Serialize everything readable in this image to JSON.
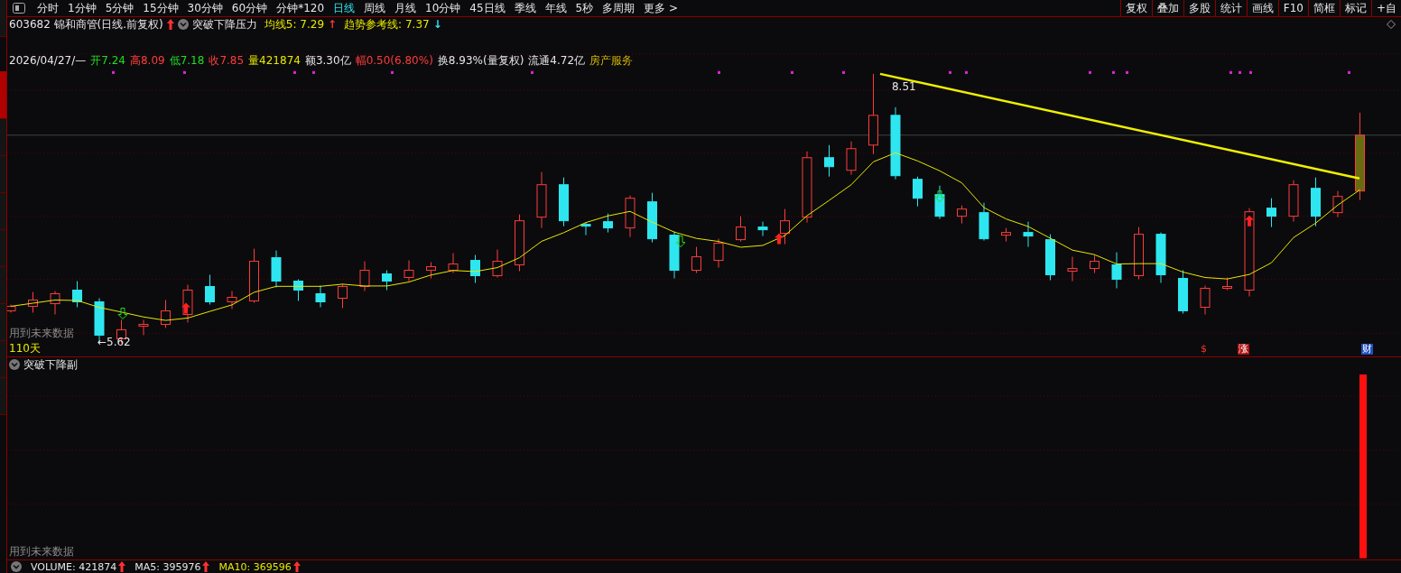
{
  "toolbar": {
    "period_tabs": [
      {
        "label": "分时",
        "selected": false
      },
      {
        "label": "1分钟",
        "selected": false
      },
      {
        "label": "5分钟",
        "selected": false
      },
      {
        "label": "15分钟",
        "selected": false
      },
      {
        "label": "30分钟",
        "selected": false
      },
      {
        "label": "60分钟",
        "selected": false
      },
      {
        "label": "分钟*120",
        "selected": false
      },
      {
        "label": "日线",
        "selected": true
      },
      {
        "label": "周线",
        "selected": false
      },
      {
        "label": "月线",
        "selected": false
      },
      {
        "label": "10分钟",
        "selected": false
      },
      {
        "label": "45日线",
        "selected": false
      },
      {
        "label": "季线",
        "selected": false
      },
      {
        "label": "年线",
        "selected": false
      },
      {
        "label": "5秒",
        "selected": false
      },
      {
        "label": "多周期",
        "selected": false
      },
      {
        "label": "更多 >",
        "selected": false
      }
    ],
    "tools": [
      "复权",
      "叠加",
      "多股",
      "统计",
      "画线",
      "F10",
      "简框",
      "标记",
      "+自"
    ]
  },
  "main_chart": {
    "stock": "603682 锦和商管(日线.前复权)",
    "formula": "突破下降压力",
    "indicators": [
      {
        "label": "均线5: 7.29",
        "arrow": "↑",
        "kind": "up"
      },
      {
        "label": "趋势参考线: 7.37",
        "arrow": "↓",
        "kind": "down"
      }
    ],
    "quote": [
      {
        "text": "2026/04/27/—",
        "kind": "plain"
      },
      {
        "text": "开7.24",
        "kind": "fall"
      },
      {
        "text": "高8.09",
        "kind": "rise"
      },
      {
        "text": "低7.18",
        "kind": "fall"
      },
      {
        "text": "收7.85",
        "kind": "rise"
      },
      {
        "text": "量421874",
        "kind": "volume"
      },
      {
        "text": "额3.30亿",
        "kind": "plain"
      },
      {
        "text": "幅0.50(6.80%)",
        "kind": "rise"
      },
      {
        "text": "换8.93%(量复权)",
        "kind": "plain"
      },
      {
        "text": "流通4.72亿",
        "kind": "plain"
      },
      {
        "text": "房产服务",
        "kind": "sector"
      }
    ],
    "peak_label": "8.51",
    "low_label": "←5.62",
    "warning": "用到未来数据",
    "days": "110天",
    "markers": [
      {
        "text": "$",
        "kind": "plain"
      },
      {
        "text": "涨",
        "kind": "rise"
      },
      {
        "text": "财",
        "kind": "finance"
      }
    ]
  },
  "sub_chart": {
    "title": "突破下降副",
    "warning": "用到未来数据"
  },
  "volume": [
    {
      "label": "VOLUME: 421874",
      "color": "#e6e6e6"
    },
    {
      "label": "MA5: 395976",
      "color": "#e6e6e6"
    },
    {
      "label": "MA10: 369596",
      "color": "#e8e800"
    }
  ]
}
